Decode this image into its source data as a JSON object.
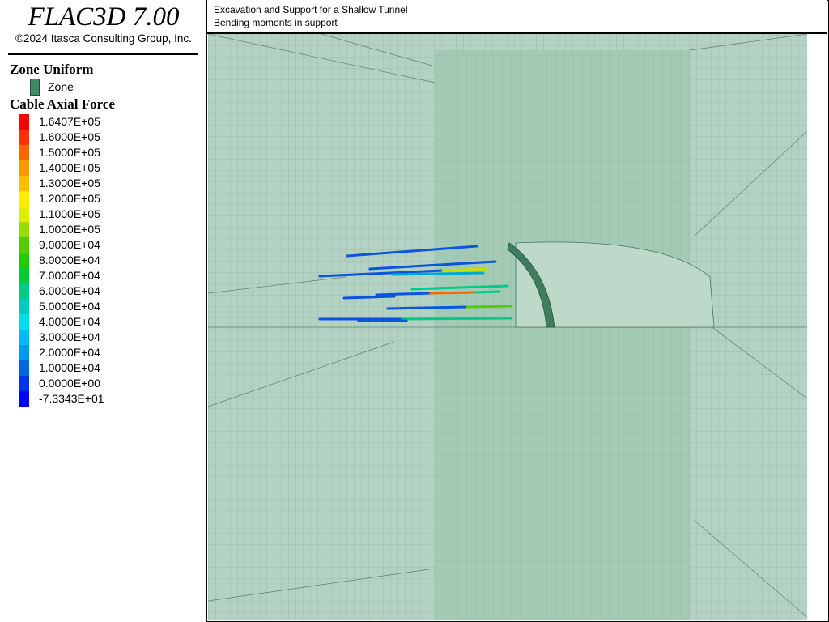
{
  "app": {
    "title": "FLAC3D 7.00",
    "copyright": "©2024 Itasca Consulting Group, Inc."
  },
  "plot": {
    "title_line1": "Excavation and Support for a Shallow Tunnel",
    "title_line2": "Bending moments in support"
  },
  "legend": {
    "zone_heading": "Zone Uniform",
    "zone_label": "Zone",
    "zone_color": "#3e8c66",
    "cable_heading": "Cable Axial Force",
    "cable_scale": [
      {
        "label": "1.6407E+05",
        "color": "#ff0000"
      },
      {
        "label": "1.6000E+05",
        "color": "#ff3300"
      },
      {
        "label": "1.5000E+05",
        "color": "#ff6600"
      },
      {
        "label": "1.4000E+05",
        "color": "#ff9900"
      },
      {
        "label": "1.3000E+05",
        "color": "#ffbb00"
      },
      {
        "label": "1.2000E+05",
        "color": "#ffee00"
      },
      {
        "label": "1.1000E+05",
        "color": "#ddee00"
      },
      {
        "label": "1.0000E+05",
        "color": "#99dd00"
      },
      {
        "label": "9.0000E+04",
        "color": "#55cc00"
      },
      {
        "label": "8.0000E+04",
        "color": "#22cc00"
      },
      {
        "label": "7.0000E+04",
        "color": "#00cc33"
      },
      {
        "label": "6.0000E+04",
        "color": "#00cc88"
      },
      {
        "label": "5.0000E+04",
        "color": "#00ccbb"
      },
      {
        "label": "4.0000E+04",
        "color": "#00ddee"
      },
      {
        "label": "3.0000E+04",
        "color": "#00bbff"
      },
      {
        "label": "2.0000E+04",
        "color": "#0099ee"
      },
      {
        "label": "1.0000E+04",
        "color": "#0066dd"
      },
      {
        "label": "0.0000E+00",
        "color": "#0033ee"
      },
      {
        "label": "-7.3343E+01",
        "color": "#0000ff"
      }
    ]
  }
}
